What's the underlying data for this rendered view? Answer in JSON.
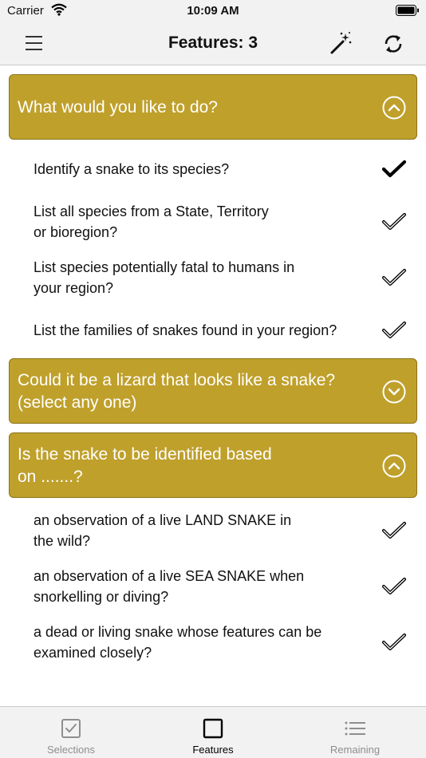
{
  "status_bar": {
    "carrier": "Carrier",
    "time": "10:09 AM"
  },
  "nav": {
    "title": "Features: 3",
    "menu_icon": "hamburger-menu-icon",
    "wand_icon": "magic-wand-icon",
    "refresh_icon": "refresh-icon"
  },
  "sections": [
    {
      "title": "What would you like to do?",
      "expanded": true,
      "options": [
        {
          "lines": [
            "Identify a snake to its species?"
          ],
          "selected": true
        },
        {
          "lines": [
            "List all species from a State, Territory",
            "or bioregion?"
          ],
          "selected": false
        },
        {
          "lines": [
            "List species potentially fatal to humans in",
            "your region?"
          ],
          "selected": false
        },
        {
          "lines": [
            "List the families of snakes found in your region?"
          ],
          "selected": false
        }
      ]
    },
    {
      "title_lines": [
        "Could it be a lizard that looks like a snake?",
        "(select any one)"
      ],
      "expanded": false
    },
    {
      "title_lines": [
        "Is the snake to be identified based",
        "on .......?"
      ],
      "expanded": true,
      "options": [
        {
          "lines": [
            "an observation of a live LAND SNAKE in",
            "the wild?"
          ],
          "selected": false
        },
        {
          "lines": [
            "an observation of a live SEA SNAKE when",
            "snorkelling or diving?"
          ],
          "selected": false
        },
        {
          "lines": [
            "a dead or living snake whose features can be",
            "examined closely?"
          ],
          "selected": false
        }
      ]
    }
  ],
  "tabs": [
    {
      "label": "Selections",
      "icon": "checkbox-icon",
      "active": false
    },
    {
      "label": "Features",
      "icon": "square-icon",
      "active": true
    },
    {
      "label": "Remaining",
      "icon": "list-icon",
      "active": false
    }
  ],
  "colors": {
    "accent": "#bfa02b",
    "accent_border": "#8b7418",
    "bar_bg": "#f2f2f2"
  }
}
